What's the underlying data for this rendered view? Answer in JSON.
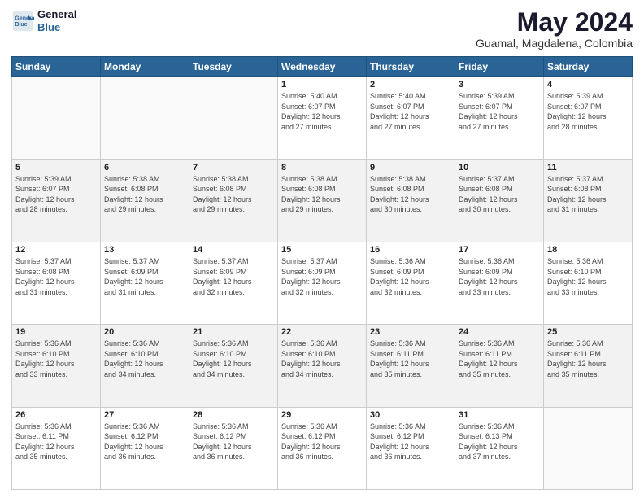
{
  "header": {
    "logo_line1": "General",
    "logo_line2": "Blue",
    "main_title": "May 2024",
    "subtitle": "Guamal, Magdalena, Colombia"
  },
  "weekdays": [
    "Sunday",
    "Monday",
    "Tuesday",
    "Wednesday",
    "Thursday",
    "Friday",
    "Saturday"
  ],
  "weeks": [
    [
      {
        "day": "",
        "info": ""
      },
      {
        "day": "",
        "info": ""
      },
      {
        "day": "",
        "info": ""
      },
      {
        "day": "1",
        "info": "Sunrise: 5:40 AM\nSunset: 6:07 PM\nDaylight: 12 hours\nand 27 minutes."
      },
      {
        "day": "2",
        "info": "Sunrise: 5:40 AM\nSunset: 6:07 PM\nDaylight: 12 hours\nand 27 minutes."
      },
      {
        "day": "3",
        "info": "Sunrise: 5:39 AM\nSunset: 6:07 PM\nDaylight: 12 hours\nand 27 minutes."
      },
      {
        "day": "4",
        "info": "Sunrise: 5:39 AM\nSunset: 6:07 PM\nDaylight: 12 hours\nand 28 minutes."
      }
    ],
    [
      {
        "day": "5",
        "info": "Sunrise: 5:39 AM\nSunset: 6:07 PM\nDaylight: 12 hours\nand 28 minutes."
      },
      {
        "day": "6",
        "info": "Sunrise: 5:38 AM\nSunset: 6:08 PM\nDaylight: 12 hours\nand 29 minutes."
      },
      {
        "day": "7",
        "info": "Sunrise: 5:38 AM\nSunset: 6:08 PM\nDaylight: 12 hours\nand 29 minutes."
      },
      {
        "day": "8",
        "info": "Sunrise: 5:38 AM\nSunset: 6:08 PM\nDaylight: 12 hours\nand 29 minutes."
      },
      {
        "day": "9",
        "info": "Sunrise: 5:38 AM\nSunset: 6:08 PM\nDaylight: 12 hours\nand 30 minutes."
      },
      {
        "day": "10",
        "info": "Sunrise: 5:37 AM\nSunset: 6:08 PM\nDaylight: 12 hours\nand 30 minutes."
      },
      {
        "day": "11",
        "info": "Sunrise: 5:37 AM\nSunset: 6:08 PM\nDaylight: 12 hours\nand 31 minutes."
      }
    ],
    [
      {
        "day": "12",
        "info": "Sunrise: 5:37 AM\nSunset: 6:08 PM\nDaylight: 12 hours\nand 31 minutes."
      },
      {
        "day": "13",
        "info": "Sunrise: 5:37 AM\nSunset: 6:09 PM\nDaylight: 12 hours\nand 31 minutes."
      },
      {
        "day": "14",
        "info": "Sunrise: 5:37 AM\nSunset: 6:09 PM\nDaylight: 12 hours\nand 32 minutes."
      },
      {
        "day": "15",
        "info": "Sunrise: 5:37 AM\nSunset: 6:09 PM\nDaylight: 12 hours\nand 32 minutes."
      },
      {
        "day": "16",
        "info": "Sunrise: 5:36 AM\nSunset: 6:09 PM\nDaylight: 12 hours\nand 32 minutes."
      },
      {
        "day": "17",
        "info": "Sunrise: 5:36 AM\nSunset: 6:09 PM\nDaylight: 12 hours\nand 33 minutes."
      },
      {
        "day": "18",
        "info": "Sunrise: 5:36 AM\nSunset: 6:10 PM\nDaylight: 12 hours\nand 33 minutes."
      }
    ],
    [
      {
        "day": "19",
        "info": "Sunrise: 5:36 AM\nSunset: 6:10 PM\nDaylight: 12 hours\nand 33 minutes."
      },
      {
        "day": "20",
        "info": "Sunrise: 5:36 AM\nSunset: 6:10 PM\nDaylight: 12 hours\nand 34 minutes."
      },
      {
        "day": "21",
        "info": "Sunrise: 5:36 AM\nSunset: 6:10 PM\nDaylight: 12 hours\nand 34 minutes."
      },
      {
        "day": "22",
        "info": "Sunrise: 5:36 AM\nSunset: 6:10 PM\nDaylight: 12 hours\nand 34 minutes."
      },
      {
        "day": "23",
        "info": "Sunrise: 5:36 AM\nSunset: 6:11 PM\nDaylight: 12 hours\nand 35 minutes."
      },
      {
        "day": "24",
        "info": "Sunrise: 5:36 AM\nSunset: 6:11 PM\nDaylight: 12 hours\nand 35 minutes."
      },
      {
        "day": "25",
        "info": "Sunrise: 5:36 AM\nSunset: 6:11 PM\nDaylight: 12 hours\nand 35 minutes."
      }
    ],
    [
      {
        "day": "26",
        "info": "Sunrise: 5:36 AM\nSunset: 6:11 PM\nDaylight: 12 hours\nand 35 minutes."
      },
      {
        "day": "27",
        "info": "Sunrise: 5:36 AM\nSunset: 6:12 PM\nDaylight: 12 hours\nand 36 minutes."
      },
      {
        "day": "28",
        "info": "Sunrise: 5:36 AM\nSunset: 6:12 PM\nDaylight: 12 hours\nand 36 minutes."
      },
      {
        "day": "29",
        "info": "Sunrise: 5:36 AM\nSunset: 6:12 PM\nDaylight: 12 hours\nand 36 minutes."
      },
      {
        "day": "30",
        "info": "Sunrise: 5:36 AM\nSunset: 6:12 PM\nDaylight: 12 hours\nand 36 minutes."
      },
      {
        "day": "31",
        "info": "Sunrise: 5:36 AM\nSunset: 6:13 PM\nDaylight: 12 hours\nand 37 minutes."
      },
      {
        "day": "",
        "info": ""
      }
    ]
  ]
}
